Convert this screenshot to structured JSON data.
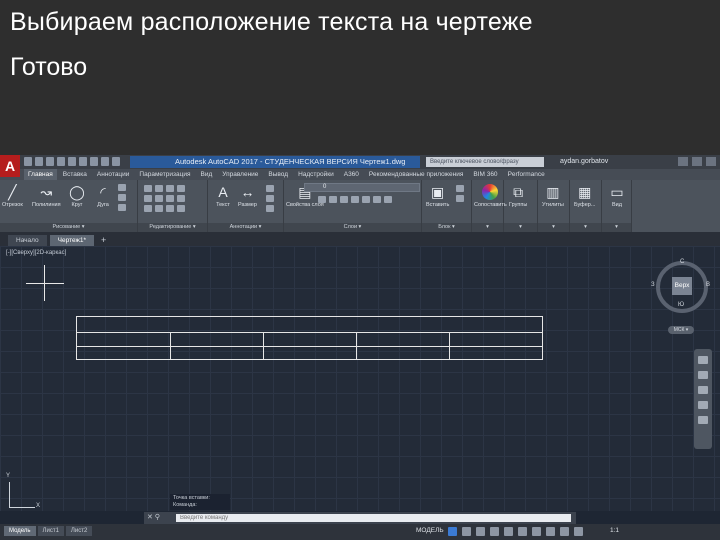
{
  "slide": {
    "title": "Выбираем расположение текста на чертеже",
    "subtitle": "Готово"
  },
  "app": {
    "logo": "A",
    "window_title": "Autodesk AutoCAD 2017 - СТУДЕНЧЕСКАЯ ВЕРСИЯ   Чертеж1.dwg",
    "search_placeholder": "Введите ключевое слово/фразу",
    "user": "aydan.gorbatov"
  },
  "ribbon_tabs": [
    "Главная",
    "Вставка",
    "Аннотации",
    "Параметризация",
    "Вид",
    "Управление",
    "Вывод",
    "Надстройки",
    "A360",
    "Рекомендованные приложения",
    "BIM 360",
    "Performance"
  ],
  "ribbon": {
    "draw": {
      "tools": [
        "Отрезок",
        "Полилиния",
        "Круг",
        "Дуга"
      ],
      "title": "Рисование ▾"
    },
    "modify": {
      "title": "Редактирование ▾"
    },
    "annotation": {
      "tools": [
        "Текст",
        "Размер"
      ],
      "title": "Аннотации ▾"
    },
    "layers": {
      "tools": [
        "Свойства слоя"
      ],
      "combo_value": "0",
      "title": "Слои ▾"
    },
    "block": {
      "tools": [
        "Вставить"
      ],
      "title": "Блок ▾"
    },
    "properties": {
      "tools": [
        "Сопоставить"
      ],
      "title": "▾"
    },
    "groups": {
      "tools": [
        "Группы"
      ],
      "title": "▾"
    },
    "utilities": {
      "tools": [
        "Утилиты"
      ],
      "title": "▾"
    },
    "clipboard": {
      "tools": [
        "Буфер..."
      ],
      "title": "▾"
    },
    "view": {
      "tools": [
        "Вид"
      ],
      "title": "▾"
    }
  },
  "file_tabs": [
    "Начало",
    "Чертеж1*"
  ],
  "viewport": {
    "label": "[-][Сверху][2D-каркас]"
  },
  "viewcube": {
    "face": "Верх",
    "n": "С",
    "s": "Ю",
    "w": "З",
    "e": "В",
    "wcs": "МСК ▾"
  },
  "drawing_table": {
    "columns_in_lower_rows": 5,
    "rows": 3
  },
  "ucs": {
    "x": "X",
    "y": "Y"
  },
  "command": {
    "history": [
      "Точка вставки:",
      "Команда:"
    ],
    "placeholder": "Введите команду"
  },
  "layout_tabs": [
    "Модель",
    "Лист1",
    "Лист2"
  ],
  "status": {
    "model": "МОДЕЛЬ",
    "scale": "1:1"
  }
}
